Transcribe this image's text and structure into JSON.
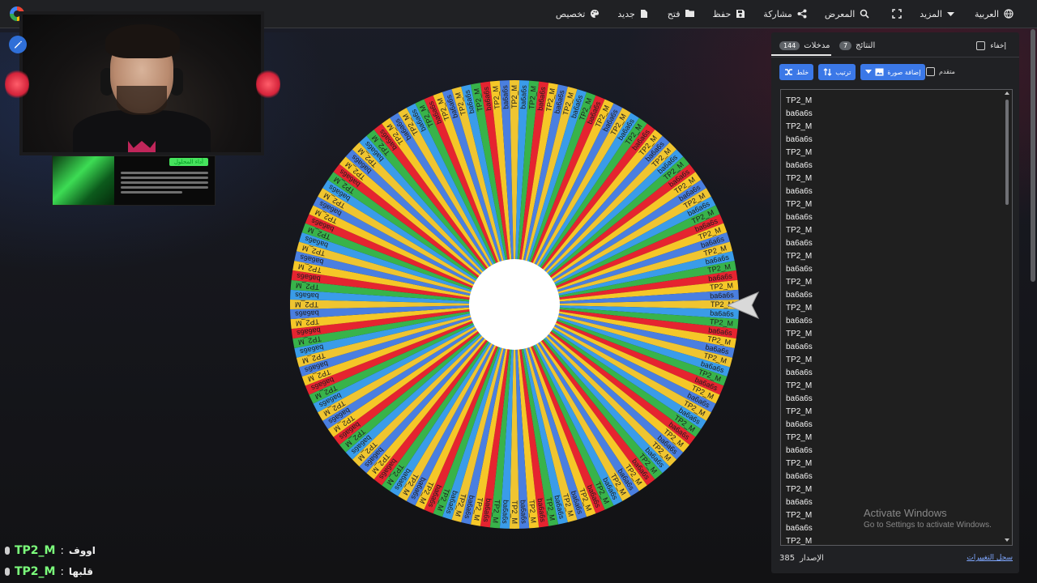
{
  "topbar": {
    "menu": [
      {
        "id": "language",
        "label": "العربية",
        "icon": "globe-icon"
      },
      {
        "id": "more",
        "label": "المزيد",
        "icon": "caret-down-icon"
      },
      {
        "id": "fullscreen",
        "label": "",
        "icon": "fullscreen-icon"
      },
      {
        "id": "gallery",
        "label": "المعرض",
        "icon": "search-icon"
      },
      {
        "id": "share",
        "label": "مشاركة",
        "icon": "share-icon"
      },
      {
        "id": "save",
        "label": "حفظ",
        "icon": "save-icon"
      },
      {
        "id": "open",
        "label": "فتح",
        "icon": "folder-icon"
      },
      {
        "id": "new",
        "label": "جديد",
        "icon": "file-icon"
      },
      {
        "id": "customize",
        "label": "تخصيص",
        "icon": "palette-icon"
      }
    ]
  },
  "panel": {
    "hide_label": "إخفاء",
    "tabs": [
      {
        "id": "entries",
        "label": "مدخلات",
        "count": "144"
      },
      {
        "id": "results",
        "label": "النتائج",
        "count": "7"
      }
    ],
    "tools": {
      "shuffle": "خلط",
      "sort": "ترتيب",
      "add_image": "إضافة صورة",
      "advanced": "متقدم"
    },
    "entries": [
      "TP2_M",
      "ba6a6s",
      "TP2_M",
      "ba6a6s",
      "TP2_M",
      "ba6a6s",
      "TP2_M",
      "ba6a6s",
      "TP2_M",
      "ba6a6s",
      "TP2_M",
      "ba6a6s",
      "TP2_M",
      "ba6a6s",
      "TP2_M",
      "ba6a6s",
      "TP2_M",
      "ba6a6s",
      "TP2_M",
      "ba6a6s",
      "TP2_M",
      "ba6a6s",
      "TP2_M",
      "ba6a6s",
      "TP2_M",
      "ba6a6s",
      "TP2_M",
      "ba6a6s",
      "TP2_M",
      "ba6a6s",
      "TP2_M",
      "ba6a6s",
      "TP2_M",
      "ba6a6s",
      "TP2_M"
    ],
    "version_label": "الإصدار",
    "version_number": "385",
    "changelog": "سجل التغييرات"
  },
  "wheel": {
    "segment_count": 144,
    "labels": [
      "TP2_M",
      "ba6a6s"
    ],
    "colors": [
      "#efc531",
      "#3a9ce9",
      "#38b34a",
      "#e52430",
      "#f5c728",
      "#4a7fe0"
    ],
    "text_color": "#1b1b1b"
  },
  "webcam": {
    "mini_card_title": "أداء المحلول"
  },
  "overlay": [
    {
      "label": "اووف",
      "name": "TP2_M"
    },
    {
      "label": "قلبها",
      "name": "TP2_M"
    }
  ],
  "watermark": {
    "title": "Activate Windows",
    "subtitle": "Go to Settings to activate Windows."
  }
}
